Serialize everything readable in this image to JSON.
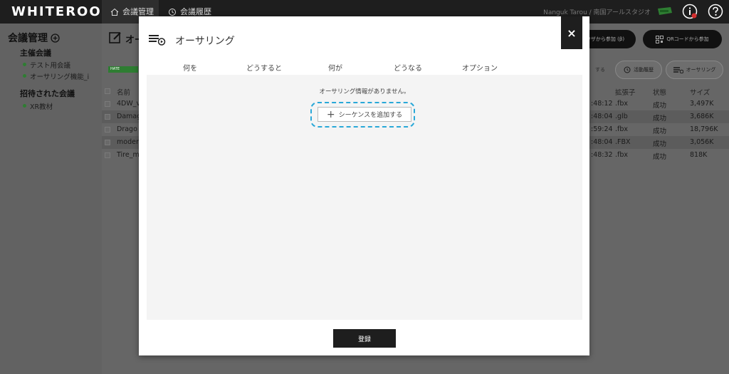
{
  "app": {
    "logo": "WHITEROOM"
  },
  "topnav": {
    "items": [
      {
        "label": "会議管理"
      },
      {
        "label": "会議履歴"
      }
    ],
    "user": "Nanguk Tarou / 南国アールスタジオ"
  },
  "sidebar": {
    "title": "会議管理",
    "hosted_heading": "主催会議",
    "hosted": [
      "テスト用会議",
      "オーサリング機能_i"
    ],
    "invited_heading": "招待された会議",
    "invited": [
      "XR教材"
    ]
  },
  "main": {
    "header": "オー",
    "badge": "HATE",
    "buttons": {
      "join_browser": "ウザから参加 (β)",
      "join_qr": "QRコードから参加",
      "something": "する",
      "history": "活動履歴",
      "authoring": "オーサリング"
    },
    "table": {
      "headers": {
        "name": "名前",
        "ext": "拡張子",
        "status": "状態",
        "size": "サイズ"
      },
      "rows": [
        {
          "name": "4DW_v",
          "time": ":48:12",
          "ext": ".fbx",
          "status": "成功",
          "size": "3,497K"
        },
        {
          "name": "Damag",
          "time": ":48:04",
          "ext": ".glb",
          "status": "成功",
          "size": "3,686K"
        },
        {
          "name": "Drago",
          "time": ":59:24",
          "ext": ".fbx",
          "status": "成功",
          "size": "18,796K"
        },
        {
          "name": "moder",
          "time": ":48:04",
          "ext": ".FBX",
          "status": "成功",
          "size": "3,056K"
        },
        {
          "name": "Tire_m",
          "time": ":48:32",
          "ext": ".fbx",
          "status": "成功",
          "size": "818K"
        }
      ]
    }
  },
  "modal": {
    "title": "オーサリング",
    "close": "×",
    "columns": [
      "何を",
      "どうすると",
      "何が",
      "どうなる",
      "オプション"
    ],
    "empty_message": "オーサリング情報がありません。",
    "add_sequence": "シーケンスを追加する",
    "register": "登録"
  },
  "colors": {
    "topbar": "#1e1e1e",
    "accent_green": "#2e7d32",
    "focus_ring": "#29a8d8"
  }
}
